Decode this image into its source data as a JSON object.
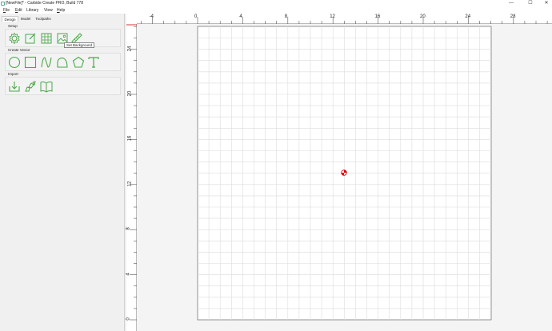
{
  "window": {
    "title": "[NewFile]* - Carbide Create PRO, Build 778",
    "controls": {
      "minimize": "—",
      "maximize": "☐",
      "close": "✕"
    }
  },
  "menu": [
    {
      "label": "File",
      "key": "F",
      "rest": "ile"
    },
    {
      "label": "Edit",
      "key": "E",
      "rest": "dit"
    },
    {
      "label": "Library",
      "key": "",
      "rest": "Library"
    },
    {
      "label": "View",
      "key": "",
      "rest": "View"
    },
    {
      "label": "Help",
      "key": "H",
      "rest": "elp"
    }
  ],
  "tabs": [
    {
      "label": "Design",
      "active": true
    },
    {
      "label": "Model",
      "active": false
    },
    {
      "label": "Toolpaths",
      "active": false
    }
  ],
  "sections": {
    "setup": {
      "label": "Setup",
      "tools": [
        "gear-icon",
        "edit-job-icon",
        "grid-icon",
        "image-background-icon",
        "ruler-icon"
      ]
    },
    "create_vector": {
      "label": "Create Vector",
      "tools": [
        "circle-icon",
        "rectangle-icon",
        "curve-icon",
        "polyline-icon",
        "polygon-icon",
        "text-icon"
      ]
    },
    "import": {
      "label": "Import",
      "tools": [
        "import-icon",
        "import-model-icon",
        "library-icon"
      ]
    }
  },
  "tooltip": "Set Background",
  "accent_color": "#4aa84a",
  "ruler": {
    "top_labels": [
      "-4",
      "0",
      "4",
      "8",
      "12",
      "16",
      "20",
      "24",
      "28"
    ],
    "left_labels": [
      "24",
      "20",
      "16",
      "12",
      "8",
      "4",
      "0"
    ]
  }
}
